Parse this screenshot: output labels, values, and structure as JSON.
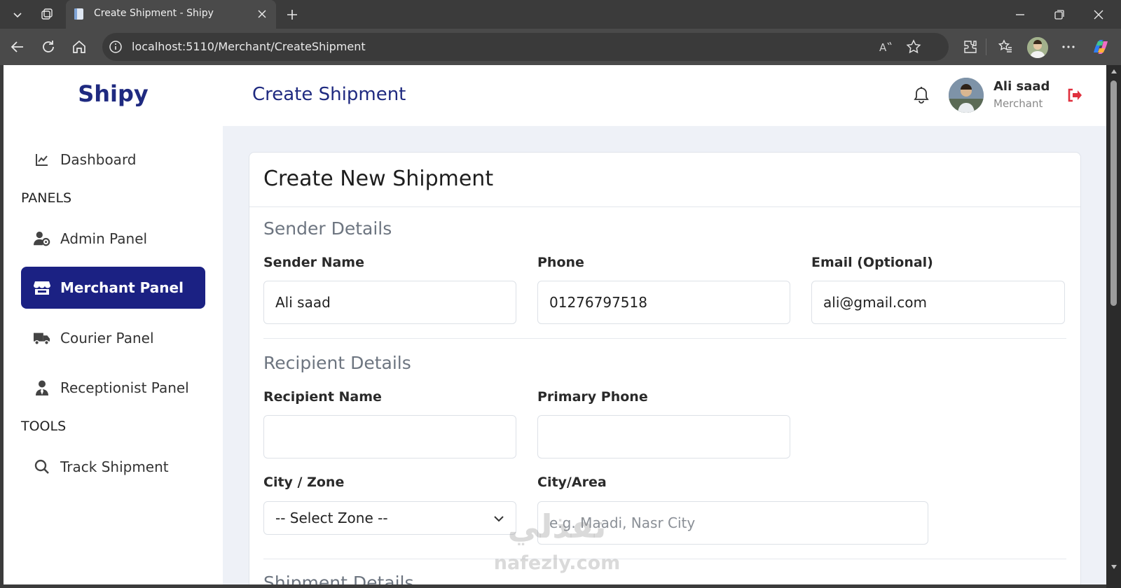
{
  "browser": {
    "tab_title": "Create Shipment - Shipy",
    "url": "localhost:5110/Merchant/CreateShipment"
  },
  "sidebar": {
    "brand": "Shipy",
    "dashboard": "Dashboard",
    "panels_heading": "PANELS",
    "admin_panel": "Admin Panel",
    "merchant_panel": "Merchant Panel",
    "courier_panel": "Courier Panel",
    "receptionist_panel": "Receptionist Panel",
    "tools_heading": "TOOLS",
    "track_shipment": "Track Shipment"
  },
  "header": {
    "title": "Create Shipment",
    "user_name": "Ali saad",
    "user_role": "Merchant"
  },
  "form": {
    "card_title": "Create New Shipment",
    "sender": {
      "title": "Sender Details",
      "name_label": "Sender Name",
      "name_value": "Ali saad",
      "phone_label": "Phone",
      "phone_value": "01276797518",
      "email_label": "Email (Optional)",
      "email_value": "ali@gmail.com"
    },
    "recipient": {
      "title": "Recipient Details",
      "name_label": "Recipient Name",
      "name_value": "",
      "phone_label": "Primary Phone",
      "phone_value": "",
      "zone_label": "City / Zone",
      "zone_selected": "-- Select Zone --",
      "area_label": "City/Area",
      "area_placeholder": "e.g. Maadi, Nasr City"
    },
    "shipment": {
      "title": "Shipment Details"
    }
  },
  "watermark": {
    "arabic": "نفذلي",
    "latin": "nafezly.com"
  },
  "colors": {
    "brand": "#1f2a80",
    "active_nav": "#1b2183",
    "logout": "#e0303e",
    "page_bg": "#eef1f7"
  }
}
